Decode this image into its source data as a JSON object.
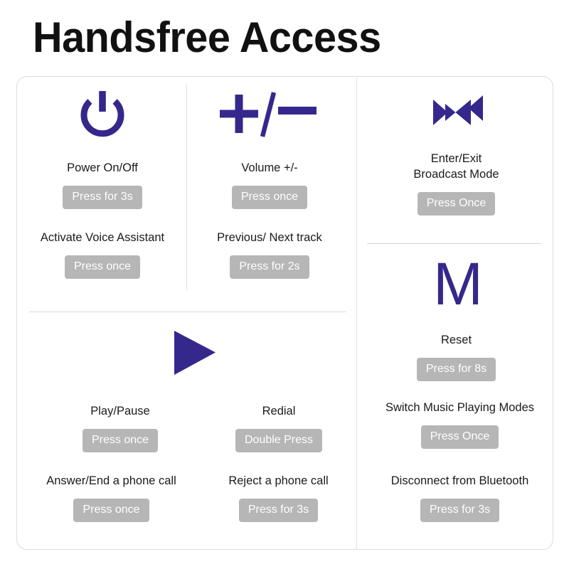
{
  "header": {
    "title": "Handsfree Access"
  },
  "theme": {
    "accent_purple": "#35288c",
    "badge_gray": "#b6b6b6",
    "badge_text": "#ffffff",
    "card_border": "#dcdcdc",
    "divider": "#e2e2e2",
    "title_color": "#111111",
    "label_color": "#1b1b1b",
    "background": "#ffffff"
  },
  "columns": [
    {
      "id": "power-column",
      "icon": "power-icon",
      "functions": [
        {
          "label": "Power On/Off",
          "badge": "Press for 3s"
        },
        {
          "label": "Activate Voice Assistant",
          "badge": "Press once"
        }
      ]
    },
    {
      "id": "volume-column",
      "icon": "volume-plus-minus-icon",
      "icon_glyph": "+/–",
      "functions": [
        {
          "label": "Volume +/-",
          "badge": "Press once"
        },
        {
          "label": "Previous/ Next track",
          "badge": "Press for 2s"
        }
      ]
    },
    {
      "id": "broadcast-column",
      "icon": "broadcast-mode-icon",
      "functions": [
        {
          "label": "Enter/Exit\nBroadcast Mode",
          "badge": "Press Once"
        }
      ]
    },
    {
      "id": "reset-column",
      "icon": "letter-m-icon",
      "icon_glyph": "M",
      "functions": [
        {
          "label": "Reset",
          "badge": "Press for 8s"
        },
        {
          "label": "Switch Music Playing Modes",
          "badge": "Press Once"
        },
        {
          "label": "Disconnect from Bluetooth",
          "badge": "Press for 3s"
        }
      ]
    },
    {
      "id": "play-column",
      "icon": "play-triangle-icon",
      "functions_left": [
        {
          "label": "Play/Pause",
          "badge": "Press once"
        },
        {
          "label": "Answer/End a phone call",
          "badge": "Press once"
        }
      ],
      "functions_right": [
        {
          "label": "Redial",
          "badge": "Double Press"
        },
        {
          "label": "Reject a phone call",
          "badge": "Press for 3s"
        }
      ]
    }
  ]
}
